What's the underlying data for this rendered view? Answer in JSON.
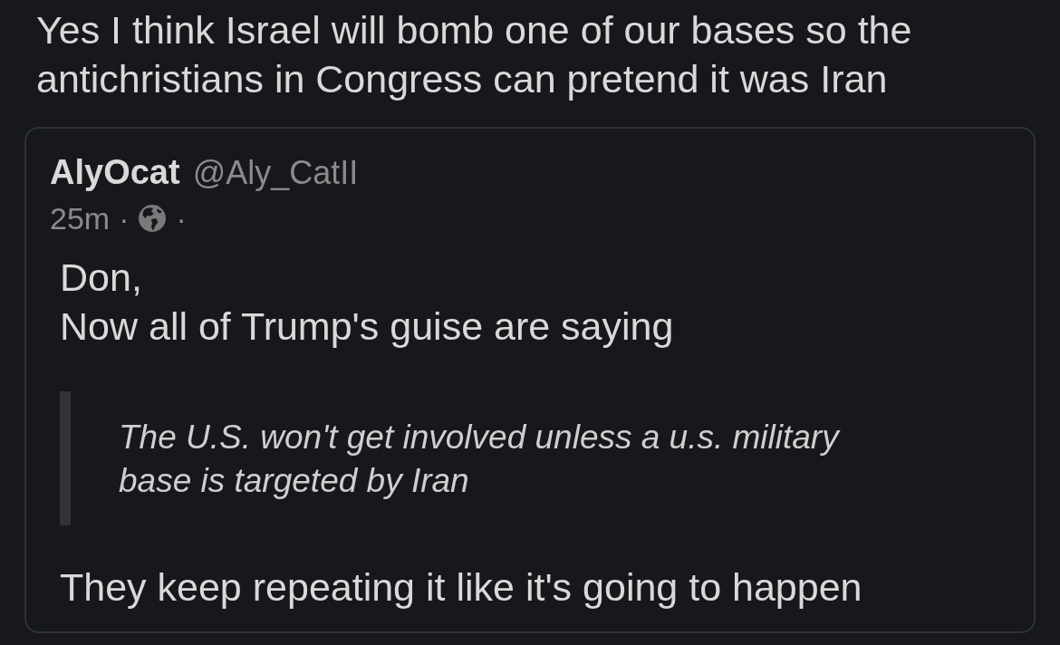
{
  "post": {
    "text": "Yes I think Israel will bomb one of our bases so the antichristians in Congress can pretend it was Iran"
  },
  "quoted_post": {
    "author_name": "AlyOcat",
    "handle": "@Aly_CatII",
    "time": "25m",
    "separators": [
      "·",
      "·"
    ],
    "body": [
      {
        "kind": "text",
        "text": "Don,"
      },
      {
        "kind": "text",
        "text": "Now all of Trump's guise are saying"
      },
      {
        "kind": "quote",
        "text": "The U.S. won't get involved unless a u.s. military base is targeted by Iran"
      },
      {
        "kind": "text",
        "text": "They keep repeating it like it's going to happen"
      }
    ]
  }
}
